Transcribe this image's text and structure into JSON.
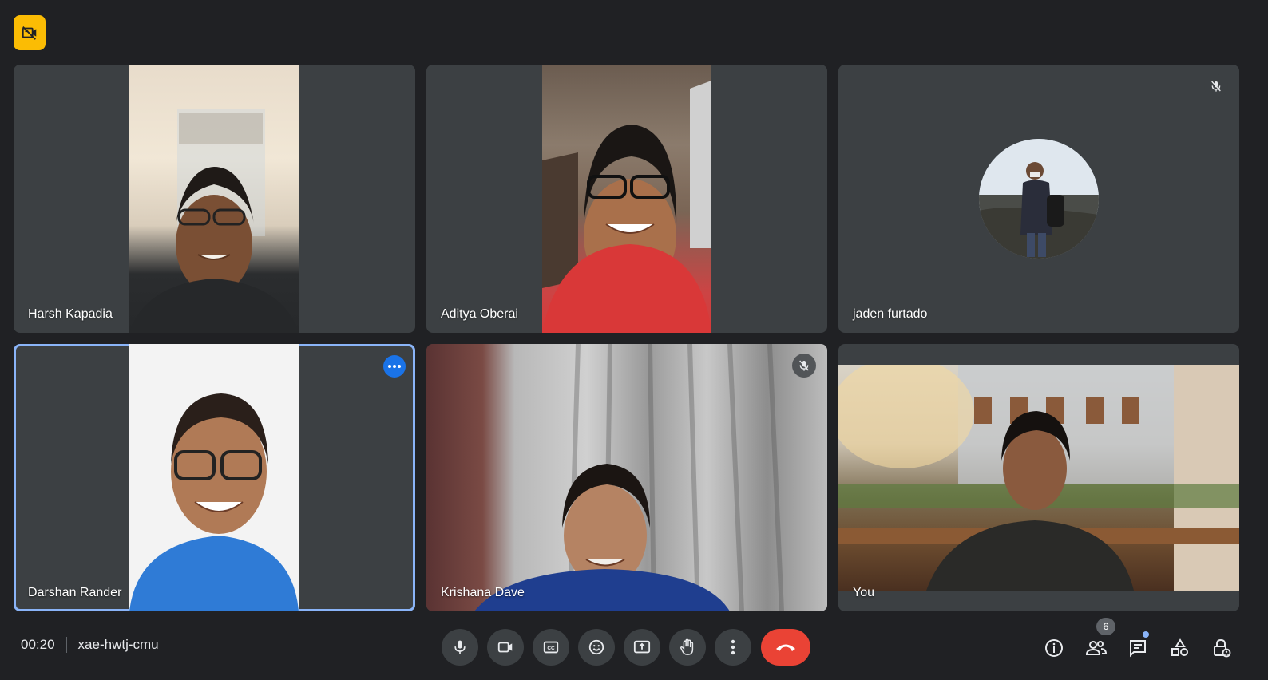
{
  "meeting": {
    "time": "00:20",
    "code": "xae-hwtj-cmu"
  },
  "participants": [
    {
      "name": "Harsh Kapadia"
    },
    {
      "name": "Aditya Oberai"
    },
    {
      "name": "jaden furtado"
    },
    {
      "name": "Darshan Rander"
    },
    {
      "name": "Krishana Dave"
    },
    {
      "name": "You"
    }
  ],
  "people_count": "6",
  "colors": {
    "background": "#202124",
    "tile": "#3c4043",
    "accent_blue": "#8ab4f8",
    "end_call": "#ea4335",
    "recording_badge": "#fbbc04"
  },
  "controls": [
    "mic-icon",
    "camera-icon",
    "captions-icon",
    "emoji-icon",
    "present-icon",
    "raise-hand-icon",
    "more-options-icon",
    "end-call-icon"
  ],
  "side_controls": [
    "info-icon",
    "people-icon",
    "chat-icon",
    "activities-icon",
    "host-controls-icon"
  ]
}
